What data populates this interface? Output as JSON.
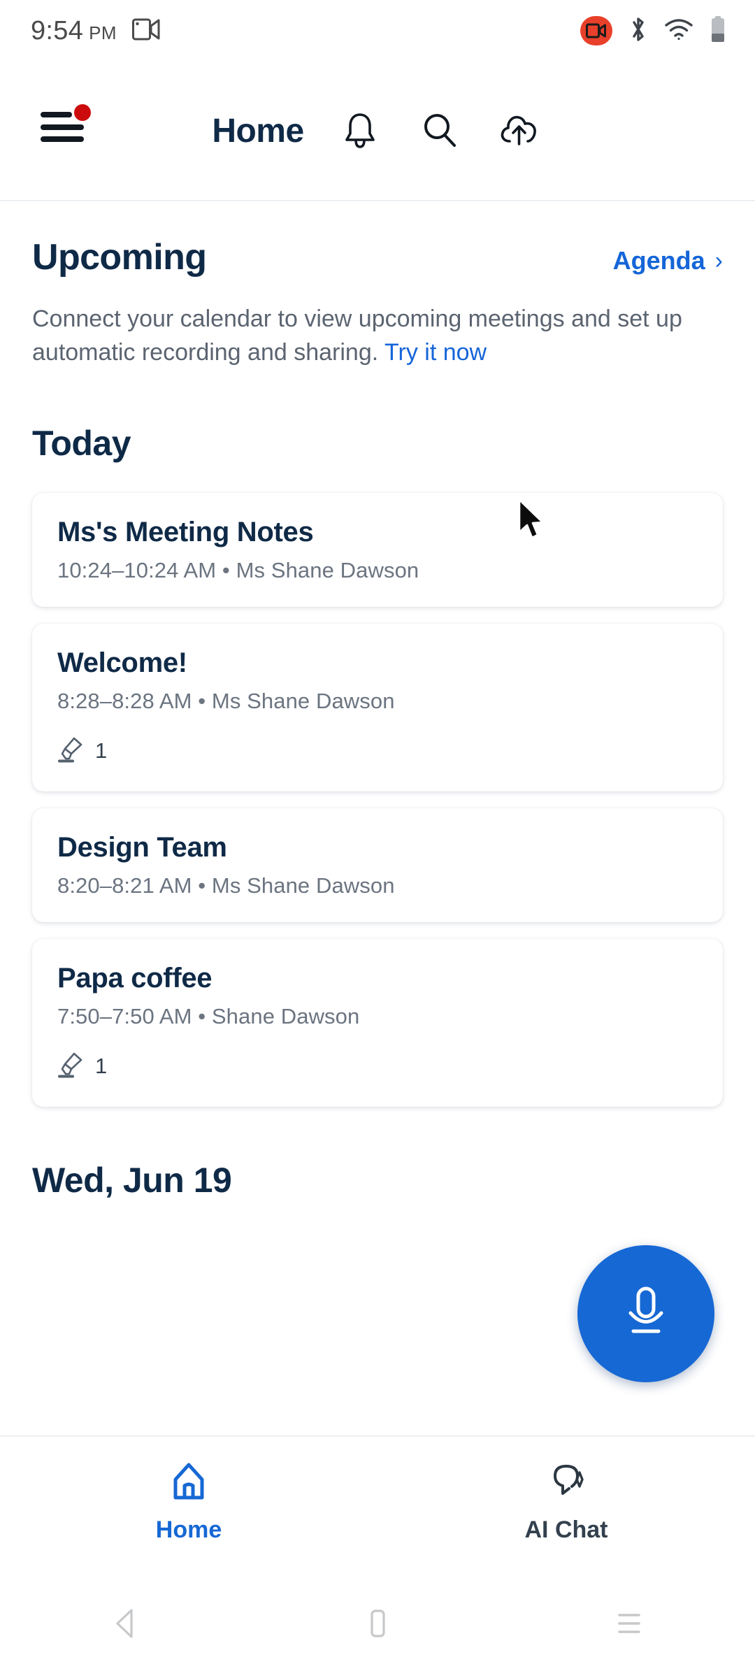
{
  "status_bar": {
    "time": "9:54",
    "ampm": "PM",
    "left_icon": "video-recording-icon",
    "right_icons": [
      "screen-record-active-icon",
      "bluetooth-icon",
      "wifi-icon",
      "battery-icon"
    ]
  },
  "header": {
    "menu_icon": "hamburger-menu-icon",
    "badge": "notification-dot",
    "title": "Home",
    "icons": [
      "bell-icon",
      "search-icon",
      "cloud-upload-icon"
    ]
  },
  "upcoming": {
    "title": "Upcoming",
    "agenda_label": "Agenda",
    "agenda_chevron": "›",
    "blurb_text": "Connect your calendar to view upcoming meetings and set up automatic recording and sharing. ",
    "blurb_link": "Try it now"
  },
  "today": {
    "title": "Today",
    "cards": [
      {
        "title": "Ms's Meeting Notes",
        "meta": "10:24–10:24 AM  •  Ms Shane Dawson",
        "has_highlight": false,
        "highlight_count": ""
      },
      {
        "title": "Welcome!",
        "meta": "8:28–8:28 AM  •  Ms Shane Dawson",
        "has_highlight": true,
        "highlight_count": "1"
      },
      {
        "title": "Design Team",
        "meta": "8:20–8:21 AM  •  Ms Shane Dawson",
        "has_highlight": false,
        "highlight_count": ""
      },
      {
        "title": "Papa coffee",
        "meta": "7:50–7:50 AM  •  Shane Dawson",
        "has_highlight": true,
        "highlight_count": "1"
      }
    ]
  },
  "next_day": {
    "title": "Wed, Jun 19"
  },
  "fab": {
    "icon": "microphone-icon"
  },
  "bottom_nav": {
    "items": [
      {
        "label": "Home",
        "icon": "home-icon",
        "active": true
      },
      {
        "label": "AI Chat",
        "icon": "ai-chat-bubble-icon",
        "active": false
      }
    ]
  },
  "system_nav": {
    "back": "back-triangle-icon",
    "home": "home-square-icon",
    "recents": "recents-lines-icon"
  },
  "colors": {
    "accent_blue": "#1668d4",
    "link_blue": "#1565d8",
    "heading_navy": "#0f2a47",
    "muted_gray": "#6b7480",
    "badge_red": "#cc0c0c",
    "record_red": "#e8402a"
  }
}
